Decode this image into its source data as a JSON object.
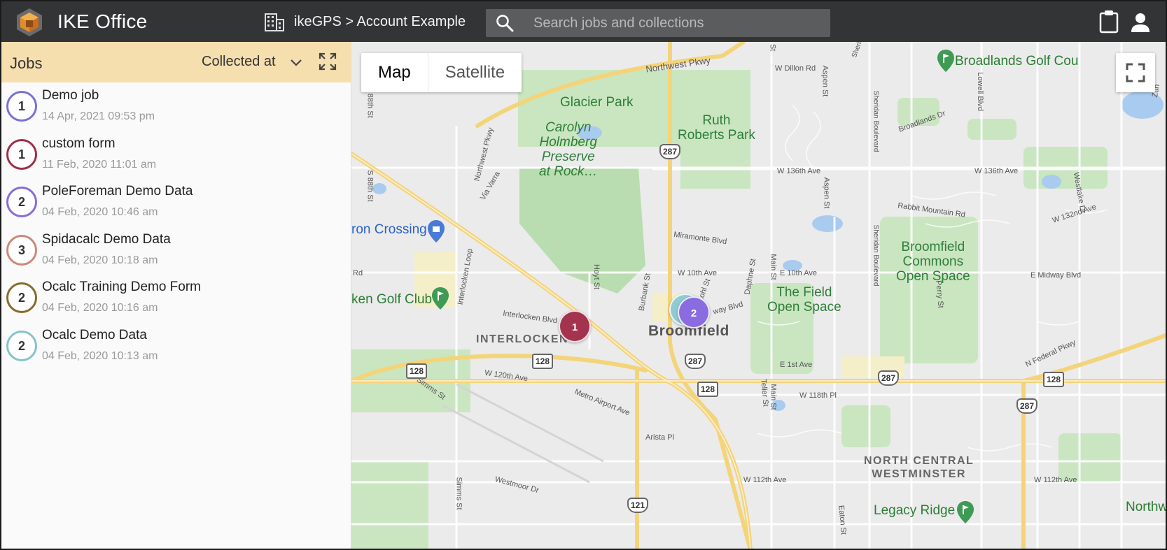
{
  "header": {
    "app_title": "IKE Office",
    "breadcrumb": "ikeGPS > Account Example",
    "search_placeholder": "Search jobs and collections"
  },
  "sidebar": {
    "title": "Jobs",
    "sort_label": "Collected at",
    "jobs": [
      {
        "count": "1",
        "name": "Demo job",
        "date": "14 Apr, 2021 09:53 pm",
        "color": "#7b6fd8"
      },
      {
        "count": "1",
        "name": "custom form",
        "date": "11 Feb, 2020 11:01 am",
        "color": "#9c3047"
      },
      {
        "count": "2",
        "name": "PoleForeman Demo Data",
        "date": "04 Feb, 2020 10:46 am",
        "color": "#8a6bd6"
      },
      {
        "count": "3",
        "name": "Spidacalc Demo Data",
        "date": "04 Feb, 2020 10:18 am",
        "color": "#c98a7a"
      },
      {
        "count": "2",
        "name": "Ocalc Training Demo Form",
        "date": "04 Feb, 2020 10:16 am",
        "color": "#8a6a2c"
      },
      {
        "count": "2",
        "name": "Ocalc Demo Data",
        "date": "04 Feb, 2020 10:13 am",
        "color": "#86c3cc"
      }
    ]
  },
  "map": {
    "type_map": "Map",
    "type_satellite": "Satellite",
    "markers": [
      {
        "label": "1",
        "color": "#a3334f"
      },
      {
        "label": "2",
        "color": "#8b6be0"
      }
    ],
    "labels": {
      "glacier_park": "Glacier Park",
      "carolyn": "Carolyn\nHolmberg\nPreserve\nat Rock…",
      "ruth": "Ruth\nRoberts Park",
      "broadlands_golf": "Broadlands Golf Cou",
      "broomfield_commons": "Broomfield\nCommons\nOpen Space",
      "the_field": "The Field\nOpen Space",
      "broomfield": "Broomfield",
      "interlocken": "INTERLOCKEN",
      "north_central": "NORTH CENTRAL\nWESTMINSTER",
      "legacy_ridge": "Legacy Ridge",
      "northw": "Northw",
      "ron_crossing": "ron Crossing",
      "ken_golf": "ken Golf Club",
      "northwest_pkwy": "Northwest Pkwy",
      "w_dillon": "W Dillon Rd",
      "w_136th_a": "W 136th Ave",
      "w_136th_b": "W 136th Ave",
      "w_132nd": "W 132nd Ave",
      "miramonte": "Miramonte Blvd",
      "w_10th": "W 10th Ave",
      "e_10th": "E 10th Ave",
      "e_midway": "E Midway Blvd",
      "e_1st": "E 1st Ave",
      "w_118th": "W 118th Pl",
      "w_112th_a": "W 112th Ave",
      "w_112th_b": "W 112th Ave",
      "w_120th": "W 120th Ave",
      "metro_airport": "Metro Airport Ave",
      "arista": "Arista Pl",
      "westmoor": "Westmoor Dr",
      "interlocken_blvd": "Interlocken Blvd",
      "interlocken_loop": "Interlocken Loop",
      "via_varra": "Via Varra",
      "simms_st": "Simms St",
      "simms_st2": "Simms St",
      "hoyt_st": "Hoyt St",
      "burbank": "Burbank St",
      "kohl": "Kohl St",
      "daphne": "Daphne St",
      "main_st": "Main St",
      "main_st2": "Main St",
      "aspen_a": "Aspen St",
      "aspen_b": "Aspen St",
      "sheridan_a": "Sheridan Boulevard",
      "sheridan_b": "Sheridan Boulevard",
      "sheridan_c": "Sheridan Boulevard",
      "lowell": "Lowell Blvd",
      "westlake": "Westlake Dr",
      "perry": "Perry St",
      "teller": "Teller St",
      "eaton": "Eaton St",
      "broadlands_dr": "Broadlands Dr",
      "rabbit_mtn": "Rabbit Mountain Rd",
      "n_federal": "N Federal Pkwy",
      "s_88th_a": "S 88th St",
      "s_88th_b": "S 88th St",
      "nw_pkwy2": "Northwest Pkwy",
      "way_blvd": "way Blvd",
      "rd": "Rd",
      "s_88th_top": "th St",
      "sheridan_top": "Sheridan",
      "zun": "Zun"
    },
    "shields": {
      "s287a": "287",
      "s287b": "287",
      "s287c": "287",
      "s287d": "287",
      "s128a": "128",
      "s128b": "128",
      "s128c": "128",
      "s128d": "128",
      "s121": "121"
    }
  }
}
